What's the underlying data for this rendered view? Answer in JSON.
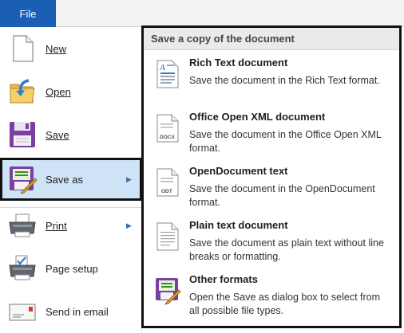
{
  "ribbon": {
    "file_tab": "File"
  },
  "menu": {
    "items": [
      {
        "label": "New",
        "icon": "new-document-icon"
      },
      {
        "label": "Open",
        "icon": "open-folder-icon"
      },
      {
        "label": "Save",
        "icon": "floppy-disk-icon"
      },
      {
        "label": "Save as",
        "icon": "save-as-icon",
        "active": true,
        "submenu": true
      },
      {
        "label": "Print",
        "icon": "printer-icon",
        "submenu": true
      },
      {
        "label": "Page setup",
        "icon": "page-setup-icon"
      },
      {
        "label": "Send in email",
        "icon": "email-icon"
      }
    ]
  },
  "submenu": {
    "header": "Save a copy of the document",
    "items": [
      {
        "title": "Rich Text document",
        "description": "Save the document in the Rich Text format.",
        "icon": "rtf-document-icon"
      },
      {
        "title": "Office Open XML document",
        "description": "Save the document in the Office Open XML format.",
        "icon": "docx-document-icon"
      },
      {
        "title": "OpenDocument text",
        "description": "Save the document in the OpenDocument format.",
        "icon": "odt-document-icon"
      },
      {
        "title": "Plain text document",
        "description": "Save the document as plain text without line breaks or formatting.",
        "icon": "plain-text-document-icon"
      },
      {
        "title": "Other formats",
        "description": "Open the Save as dialog box to select from all possible file types.",
        "icon": "save-as-icon"
      }
    ],
    "doc_labels": {
      "docx": "DOCX",
      "odt": "ODT"
    }
  },
  "colors": {
    "file_tab": "#1a5fb4",
    "active_item": "#cfe3f7",
    "outline": "#111111"
  }
}
